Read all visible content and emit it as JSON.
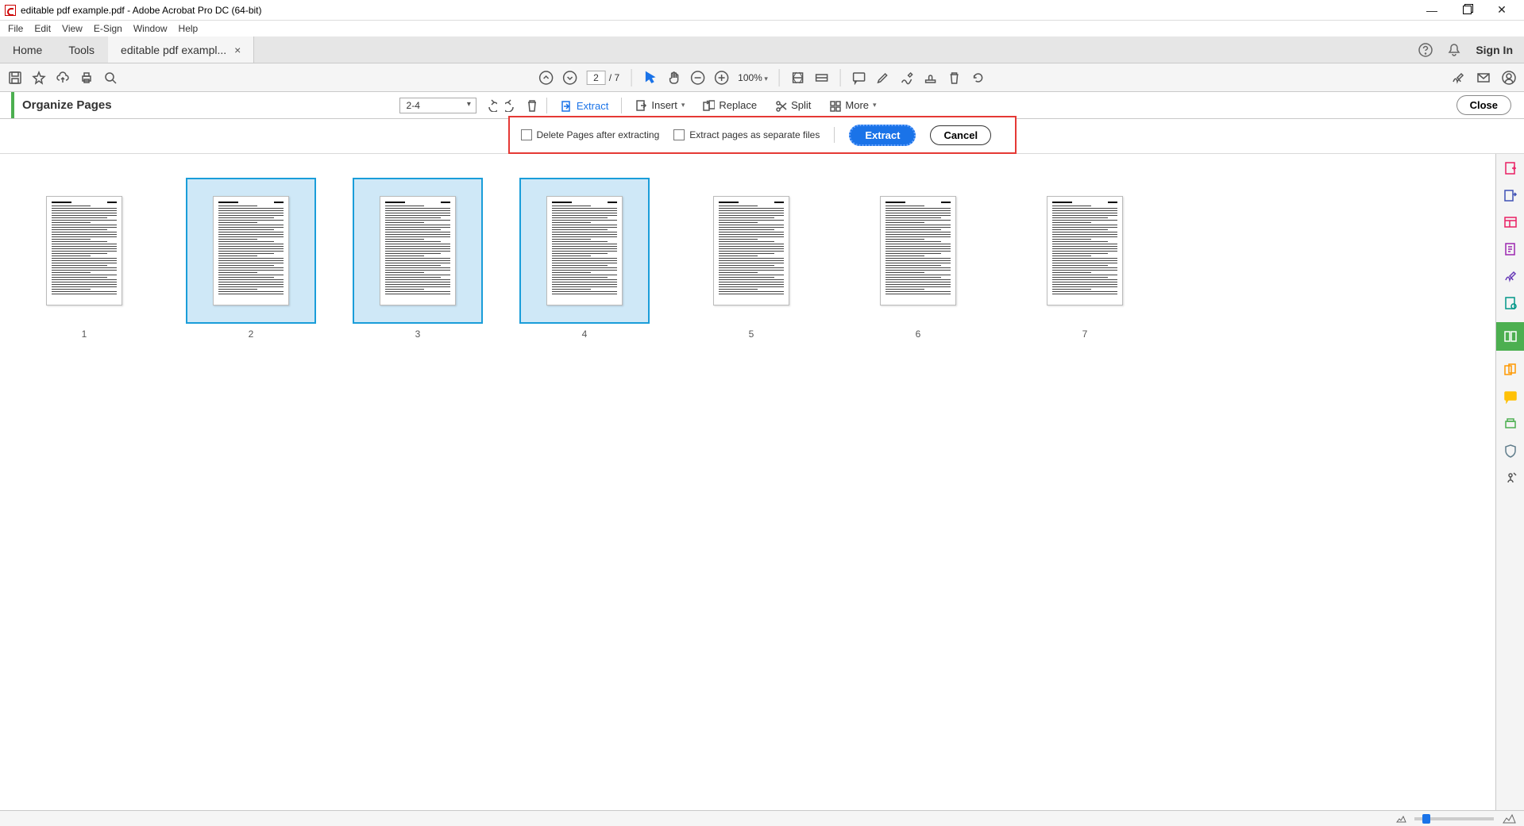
{
  "window": {
    "title": "editable pdf example.pdf - Adobe Acrobat Pro DC (64-bit)"
  },
  "menu": [
    "File",
    "Edit",
    "View",
    "E-Sign",
    "Window",
    "Help"
  ],
  "tabs": {
    "home": "Home",
    "tools": "Tools",
    "doc": "editable pdf exampl...",
    "signin": "Sign In"
  },
  "toolbar": {
    "page_current": "2",
    "page_total": "/ 7",
    "zoom": "100%"
  },
  "organize": {
    "title": "Organize Pages",
    "range": "2-4",
    "extract": "Extract",
    "insert": "Insert",
    "replace": "Replace",
    "split": "Split",
    "more": "More",
    "close": "Close"
  },
  "extract_bar": {
    "delete_after": "Delete Pages after extracting",
    "separate_files": "Extract pages as separate files",
    "extract_btn": "Extract",
    "cancel_btn": "Cancel"
  },
  "pages": [
    {
      "num": "1",
      "selected": false
    },
    {
      "num": "2",
      "selected": true
    },
    {
      "num": "3",
      "selected": true
    },
    {
      "num": "4",
      "selected": true
    },
    {
      "num": "5",
      "selected": false
    },
    {
      "num": "6",
      "selected": false
    },
    {
      "num": "7",
      "selected": false
    }
  ]
}
